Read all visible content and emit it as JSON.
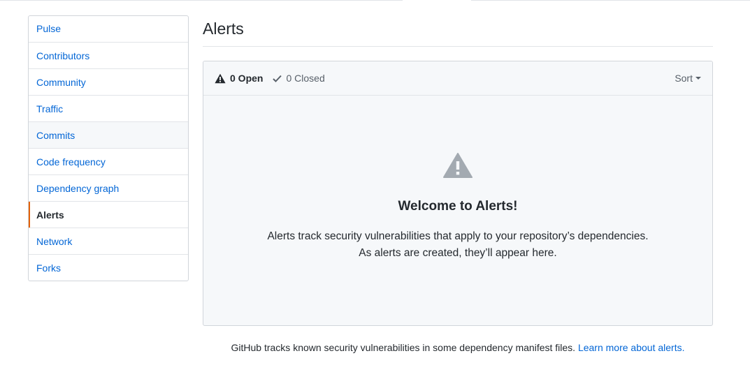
{
  "sidebar": {
    "items": [
      {
        "label": "Pulse"
      },
      {
        "label": "Contributors"
      },
      {
        "label": "Community"
      },
      {
        "label": "Traffic"
      },
      {
        "label": "Commits"
      },
      {
        "label": "Code frequency"
      },
      {
        "label": "Dependency graph"
      },
      {
        "label": "Alerts",
        "selected": true
      },
      {
        "label": "Network"
      },
      {
        "label": "Forks"
      }
    ],
    "selected_accent": "#e36209"
  },
  "main": {
    "title": "Alerts",
    "tabs": {
      "open_label": "0 Open",
      "open_icon": "alert-icon",
      "closed_label": "0 Closed",
      "closed_icon": "check-icon"
    },
    "sort_label": "Sort",
    "blank": {
      "icon": "alert-icon",
      "title": "Welcome to Alerts!",
      "line1": "Alerts track security vulnerabilities that apply to your repository’s dependencies.",
      "line2": "As alerts are created, they’ll appear here."
    },
    "footer": {
      "text": "GitHub tracks known security vulnerabilities in some dependency manifest files.",
      "link_label": "Learn more about alerts."
    }
  },
  "colors": {
    "link": "#0366d6",
    "text": "#24292e",
    "muted": "#586069",
    "border": "#d1d5da",
    "panel_bg": "#f6f8fa"
  }
}
